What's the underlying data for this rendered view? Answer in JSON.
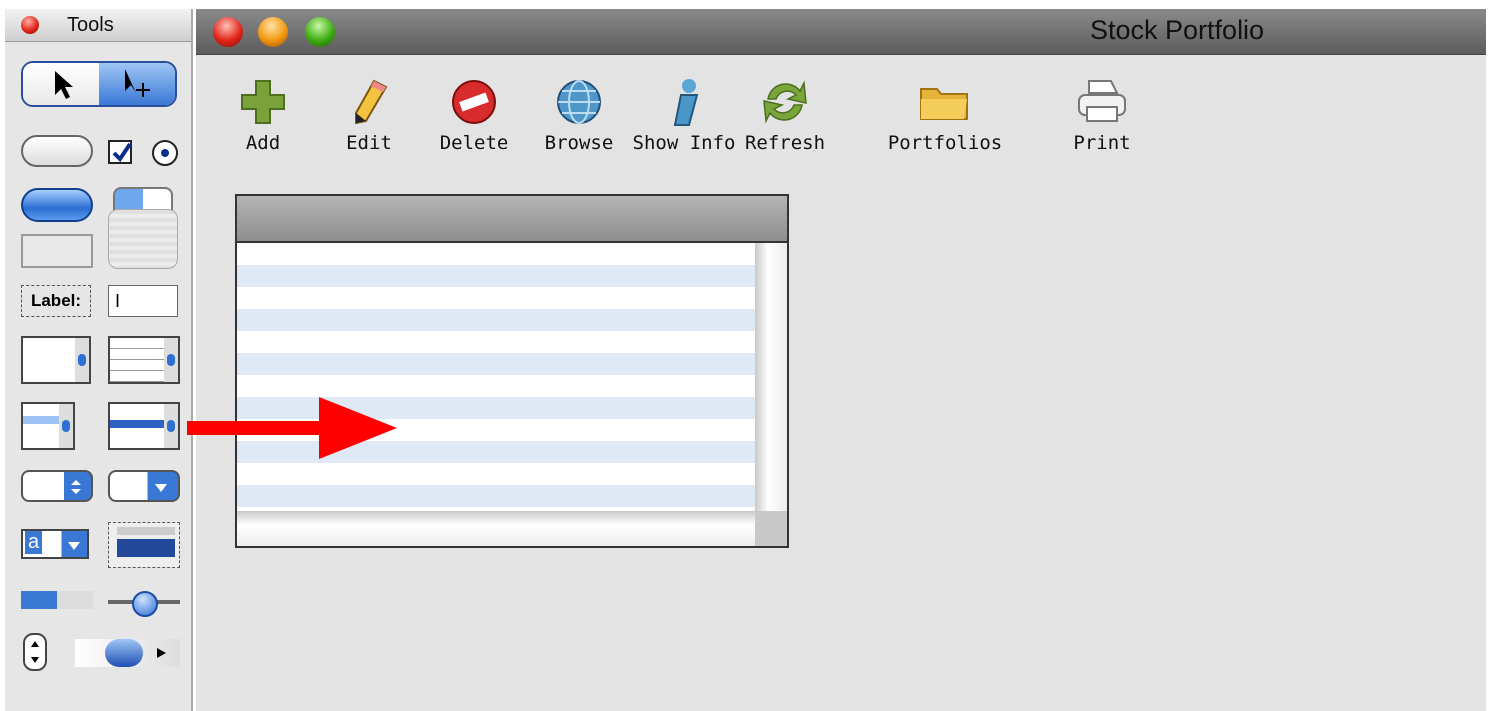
{
  "tools_palette": {
    "title": "Tools",
    "label_tool_text": "Label:",
    "text_field_cursor": "I",
    "text_combo_letter": "a"
  },
  "window": {
    "title": "Stock Portfolio"
  },
  "toolbar": [
    {
      "label": "Add",
      "icon": "add-icon"
    },
    {
      "label": "Edit",
      "icon": "pencil-icon"
    },
    {
      "label": "Delete",
      "icon": "delete-icon"
    },
    {
      "label": "Browse",
      "icon": "globe-icon"
    },
    {
      "label": "Show Info",
      "icon": "info-icon"
    },
    {
      "label": "Refresh",
      "icon": "refresh-icon"
    },
    {
      "label": "Portfolios",
      "icon": "folder-icon"
    },
    {
      "label": "Print",
      "icon": "printer-icon"
    }
  ],
  "colors": {
    "row_stripe": "#dfe8f5",
    "annotation_arrow": "#ff0000",
    "accent_blue": "#3a78d6"
  }
}
